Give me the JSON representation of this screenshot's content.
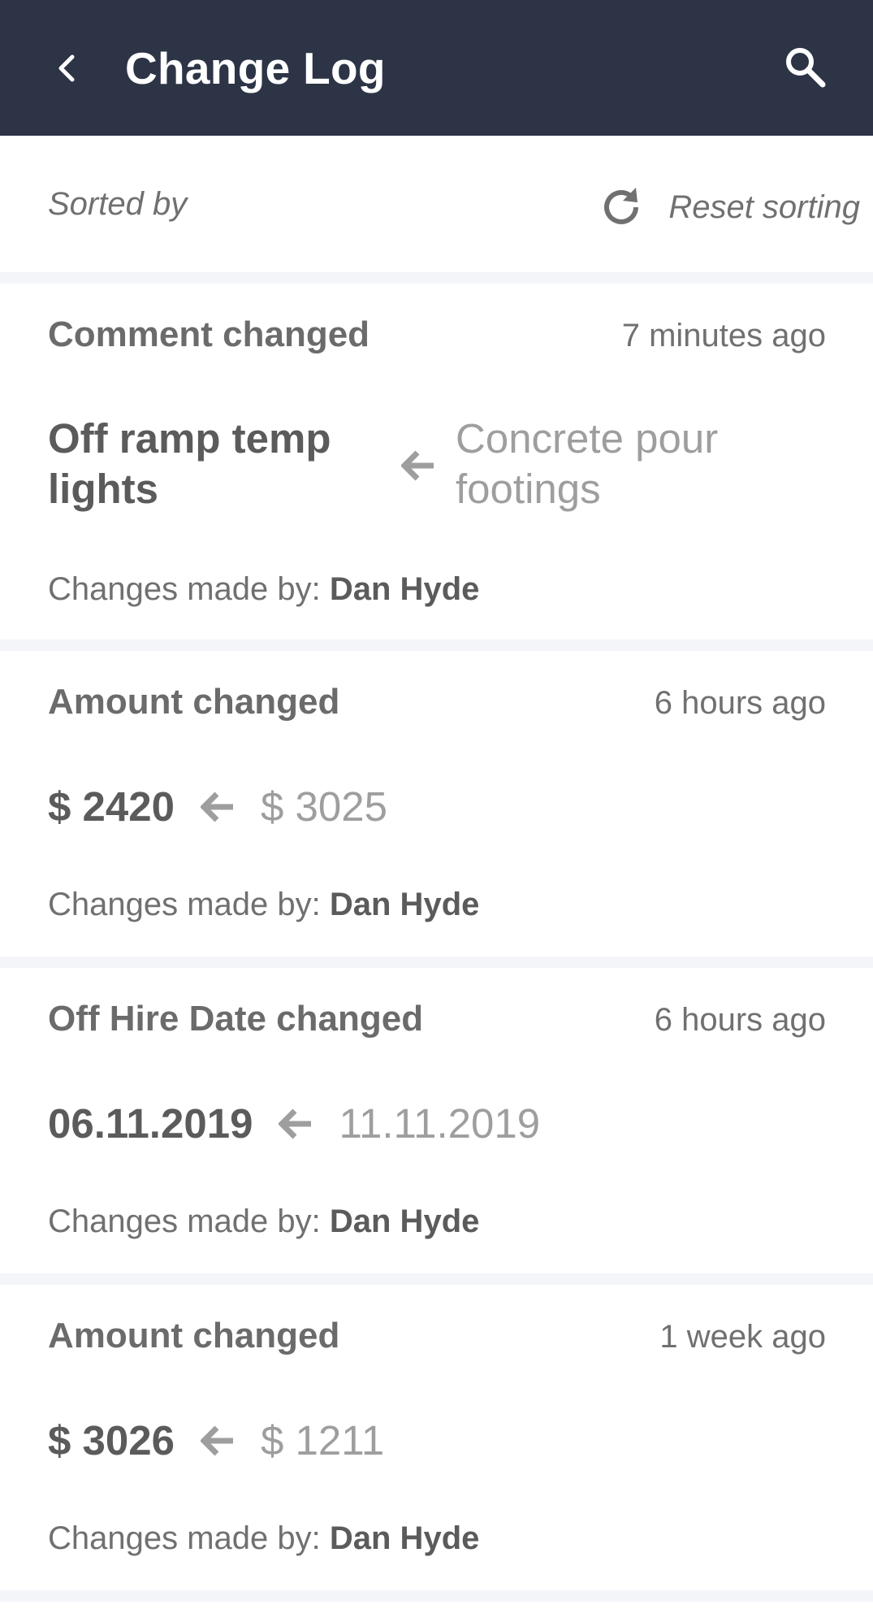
{
  "header": {
    "title": "Change Log"
  },
  "sort": {
    "label": "Sorted by",
    "reset_label": "Reset sorting"
  },
  "entries": [
    {
      "title": "Comment changed",
      "time": "7 minutes ago",
      "new_value": "Off ramp temp lights",
      "old_value": "Concrete pour footings",
      "author_prefix": "Changes made by: ",
      "author": "Dan Hyde"
    },
    {
      "title": "Amount changed",
      "time": "6 hours ago",
      "new_value": "$ 2420",
      "old_value": "$ 3025",
      "author_prefix": "Changes made by: ",
      "author": "Dan Hyde"
    },
    {
      "title": "Off Hire Date changed",
      "time": "6 hours ago",
      "new_value": "06.11.2019",
      "old_value": "11.11.2019",
      "author_prefix": "Changes made by: ",
      "author": "Dan Hyde"
    },
    {
      "title": "Amount changed",
      "time": "1 week ago",
      "new_value": "$ 3026",
      "old_value": "$ 1211",
      "author_prefix": "Changes made by: ",
      "author": "Dan Hyde"
    }
  ],
  "icons": {
    "back": "back-chevron-icon",
    "search": "search-icon",
    "reset": "refresh-icon",
    "arrow": "arrow-left-icon"
  },
  "colors": {
    "appbar": "#2c3446",
    "divider": "#f3f5f9",
    "text": "#616161",
    "old_value": "#9e9e9e"
  }
}
